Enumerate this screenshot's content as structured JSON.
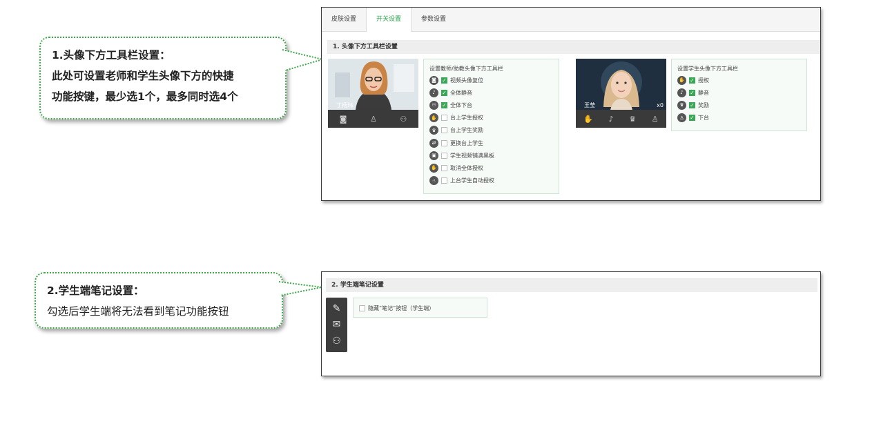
{
  "callout1": {
    "lines": [
      "1.头像下方工具栏设置：",
      "此处可设置老师和学生头像下方的快捷",
      "功能按键，最少选1个，最多同时选4个"
    ]
  },
  "callout2": {
    "lines": [
      "2.学生端笔记设置：",
      "勾选后学生端将无法看到笔记功能按钮"
    ]
  },
  "tabs": [
    "皮肤设置",
    "开关设置",
    "参数设置"
  ],
  "section1": {
    "title": "1. 头像下方工具栏设置",
    "teacher": {
      "name": "丁杨玮",
      "toolbar_icons": [
        "camera-icon",
        "mic-person-icon",
        "users-down-icon"
      ],
      "options_title": "设置教师/助教头像下方工具栏",
      "options": [
        {
          "label": "视频头像复位",
          "checked": true,
          "icon": "camera-icon"
        },
        {
          "label": "全体静音",
          "checked": true,
          "icon": "mute-all-icon"
        },
        {
          "label": "全体下台",
          "checked": true,
          "icon": "users-down-icon"
        },
        {
          "label": "台上学生授权",
          "checked": false,
          "icon": "hand-icon"
        },
        {
          "label": "台上学生奖励",
          "checked": false,
          "icon": "trophy-icon"
        },
        {
          "label": "更换台上学生",
          "checked": false,
          "icon": "swap-icon"
        },
        {
          "label": "学生视频铺满黑板",
          "checked": false,
          "icon": "fullscreen-icon"
        },
        {
          "label": "取消全体授权",
          "checked": false,
          "icon": "hand-cancel-icon"
        },
        {
          "label": "上台学生自动授权",
          "checked": false,
          "icon": "auto-hand-icon"
        }
      ]
    },
    "student": {
      "name": "王莹",
      "trophy_count": "x0",
      "toolbar_icons": [
        "hand-icon",
        "mute-icon",
        "trophy-icon",
        "user-down-icon"
      ],
      "options_title": "设置学生头像下方工具栏",
      "options": [
        {
          "label": "授权",
          "checked": true,
          "icon": "hand-icon"
        },
        {
          "label": "静音",
          "checked": true,
          "icon": "mute-icon"
        },
        {
          "label": "奖励",
          "checked": true,
          "icon": "trophy-icon"
        },
        {
          "label": "下台",
          "checked": true,
          "icon": "user-down-icon"
        }
      ]
    }
  },
  "section2": {
    "title": "2. 学生端笔记设置",
    "option": {
      "label": "隐藏“笔记”按钮（学生端）",
      "checked": false
    },
    "sidebar_icons": [
      "edit-note-icon",
      "chat-icon",
      "users-icon"
    ]
  },
  "colors": {
    "accent": "#2ea44f",
    "callout_border": "#3da84a",
    "checkbox_on": "#3aa757"
  }
}
